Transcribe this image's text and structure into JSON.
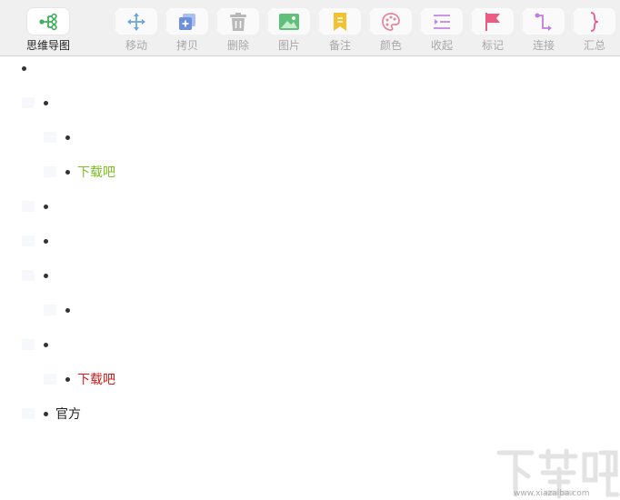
{
  "toolbar": {
    "buttons": [
      {
        "id": "mindmap",
        "label": "思维导图",
        "icon": "mindmap-icon",
        "active": true
      },
      {
        "id": "move",
        "label": "移动",
        "icon": "move-arrows-icon"
      },
      {
        "id": "copy",
        "label": "拷贝",
        "icon": "copy-icon"
      },
      {
        "id": "delete",
        "label": "删除",
        "icon": "trash-icon"
      },
      {
        "id": "image",
        "label": "图片",
        "icon": "image-icon"
      },
      {
        "id": "note",
        "label": "备注",
        "icon": "note-icon"
      },
      {
        "id": "color",
        "label": "颜色",
        "icon": "palette-icon"
      },
      {
        "id": "collapse",
        "label": "收起",
        "icon": "collapse-icon"
      },
      {
        "id": "mark",
        "label": "标记",
        "icon": "flag-icon"
      },
      {
        "id": "connect",
        "label": "连接",
        "icon": "connector-icon"
      },
      {
        "id": "summary",
        "label": "汇总",
        "icon": "brace-icon"
      }
    ]
  },
  "outline": {
    "nodes": [
      {
        "level": 0,
        "text": ""
      },
      {
        "level": 1,
        "text": ""
      },
      {
        "level": 2,
        "text": ""
      },
      {
        "level": 2,
        "text": "下载吧",
        "color": "#7cc020"
      },
      {
        "level": 1,
        "text": ""
      },
      {
        "level": 1,
        "text": ""
      },
      {
        "level": 1,
        "text": ""
      },
      {
        "level": 2,
        "text": ""
      },
      {
        "level": 1,
        "text": ""
      },
      {
        "level": 2,
        "text": "下载吧",
        "color": "#d51b1b"
      },
      {
        "level": 1,
        "text": "官方",
        "color": "#222222"
      }
    ]
  },
  "watermark": {
    "logo": "下载吧",
    "url": "www.xiazaiba.com"
  },
  "colors": {
    "accent_green": "#3db15b",
    "move": "#6aa6e0",
    "copy": "#6d8fe0",
    "trash": "#b9b9b9",
    "image": "#5fc07a",
    "note": "#f2c230",
    "palette": "#e28a9c",
    "collapse": "#c089e0",
    "flag": "#ee5a84",
    "connector": "#c37ce2",
    "brace": "#ec5a8d"
  }
}
